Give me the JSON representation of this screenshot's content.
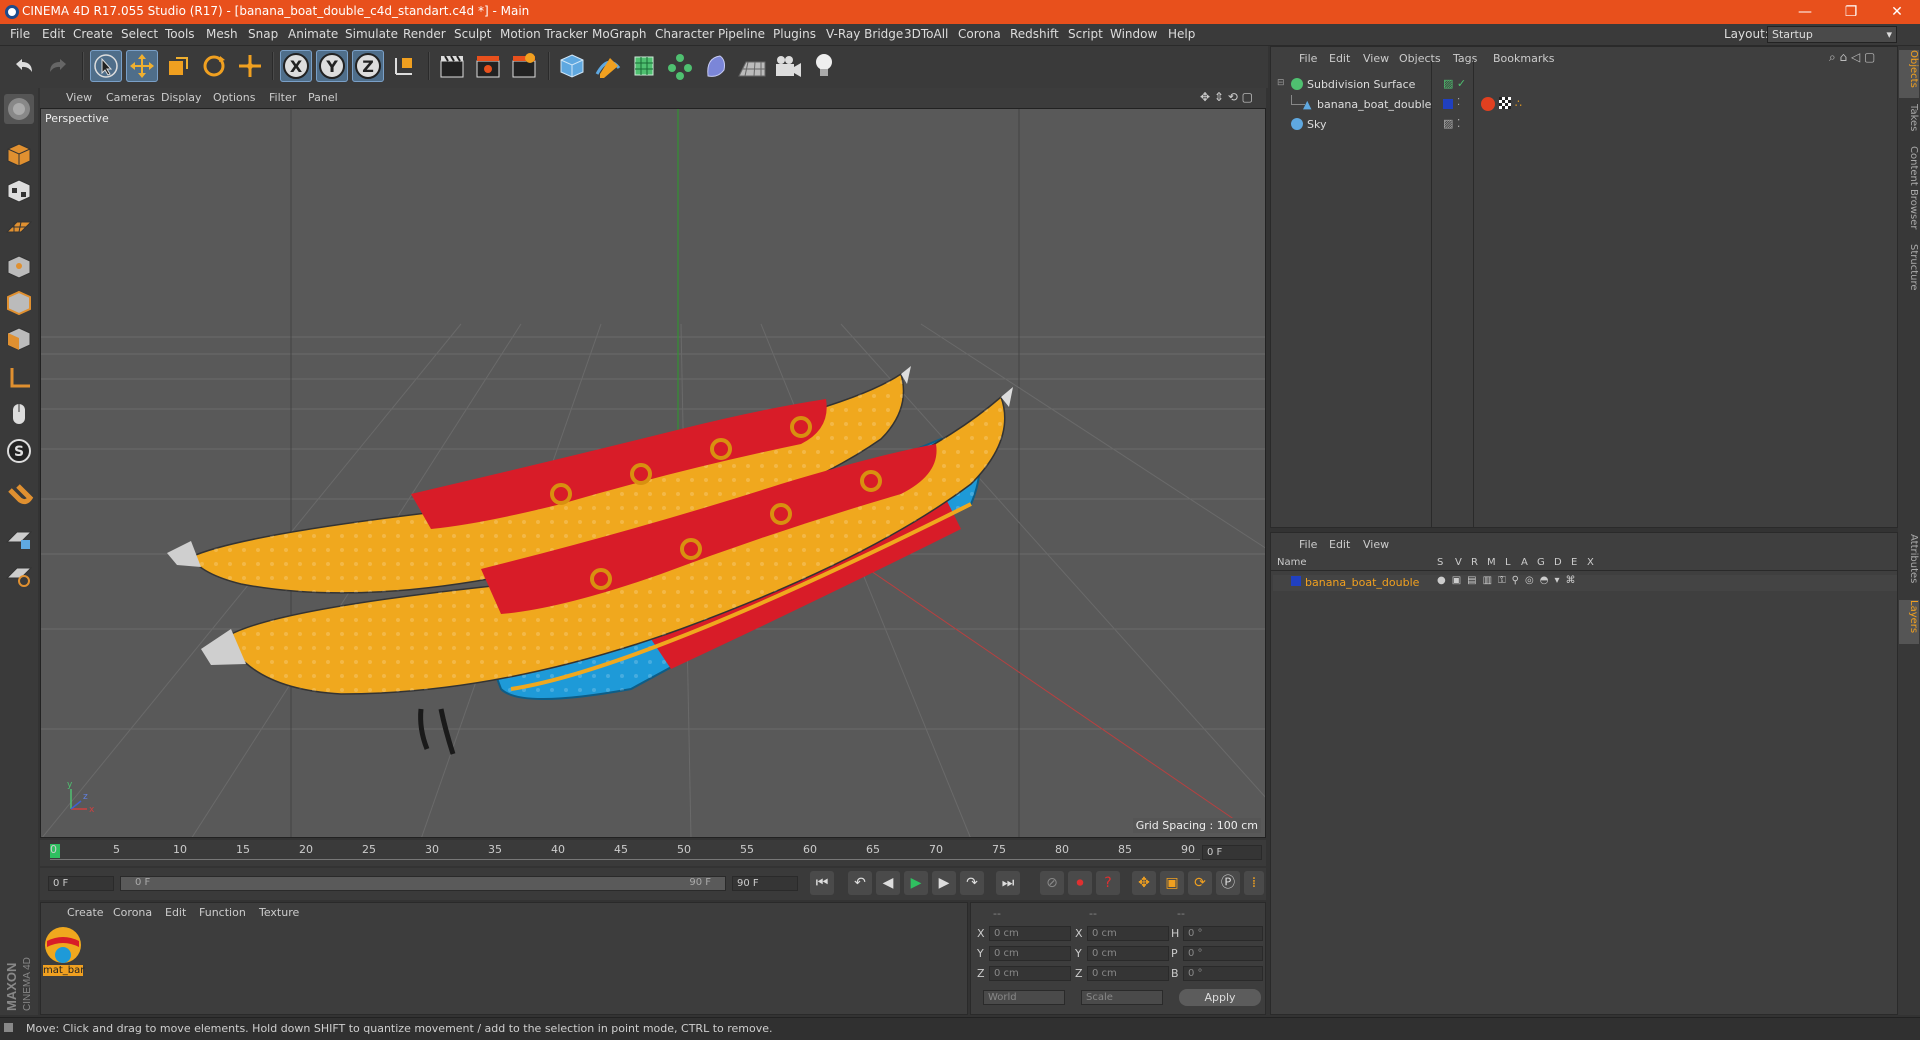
{
  "title_bar": {
    "title": "CINEMA 4D R17.055 Studio (R17) - [banana_boat_double_c4d_standart.c4d *] - Main",
    "controls": [
      "—",
      "❐",
      "✕"
    ]
  },
  "menu": {
    "items": [
      "File",
      "Edit",
      "Create",
      "Select",
      "Tools",
      "Mesh",
      "Snap",
      "Animate",
      "Simulate",
      "Render",
      "Sculpt",
      "Motion Tracker",
      "MoGraph",
      "Character",
      "Pipeline",
      "Plugins",
      "V-Ray Bridge",
      "3DToAll",
      "Corona",
      "Redshift",
      "Script",
      "Window",
      "Help"
    ],
    "layout_label": "Layout:",
    "layout_value": "Startup"
  },
  "toolbar": {
    "axis_x": "X",
    "axis_y": "Y",
    "axis_z": "Z"
  },
  "viewport": {
    "menu": [
      "View",
      "Cameras",
      "Display",
      "Options",
      "Filter",
      "Panel"
    ],
    "camera_label": "Perspective",
    "grid_spacing": "Grid Spacing : 100 cm"
  },
  "timeline": {
    "ticks": [
      "0",
      "5",
      "10",
      "15",
      "20",
      "25",
      "30",
      "35",
      "40",
      "45",
      "50",
      "55",
      "60",
      "65",
      "70",
      "75",
      "80",
      "85",
      "90"
    ],
    "current_frame": "0 F",
    "start_frame": "0 F",
    "range_start": "0 F",
    "range_end": "90 F",
    "end_frame": "90 F"
  },
  "material_panel": {
    "menu": [
      "Create",
      "Corona",
      "Edit",
      "Function",
      "Texture"
    ],
    "materials": [
      {
        "name": "mat_bar"
      }
    ]
  },
  "coordinates": {
    "headers": [
      "--",
      "--",
      "--"
    ],
    "rows": [
      {
        "l1": "X",
        "v1": "0 cm",
        "l2": "X",
        "v2": "0 cm",
        "l3": "H",
        "v3": "0 °"
      },
      {
        "l1": "Y",
        "v1": "0 cm",
        "l2": "Y",
        "v2": "0 cm",
        "l3": "P",
        "v3": "0 °"
      },
      {
        "l1": "Z",
        "v1": "0 cm",
        "l2": "Z",
        "v2": "0 cm",
        "l3": "B",
        "v3": "0 °"
      }
    ],
    "mode": "World",
    "type": "Scale",
    "apply": "Apply"
  },
  "objects_panel": {
    "menu": [
      "File",
      "Edit",
      "View",
      "Objects",
      "Tags",
      "Bookmarks"
    ],
    "objects": [
      {
        "name": "Subdivision Surface"
      },
      {
        "name": "banana_boat_double"
      },
      {
        "name": "Sky"
      }
    ]
  },
  "layers_panel": {
    "menu": [
      "File",
      "Edit",
      "View"
    ],
    "columns": [
      "Name",
      "S",
      "V",
      "R",
      "M",
      "L",
      "A",
      "G",
      "D",
      "E",
      "X"
    ],
    "layers": [
      {
        "name": "banana_boat_double"
      }
    ]
  },
  "right_tabs": [
    "Objects",
    "Takes",
    "Content Browser",
    "Structure",
    "Attributes",
    "Layers"
  ],
  "branding": "MAXON CINEMA 4D",
  "status": "Move: Click and drag to move elements. Hold down SHIFT to quantize movement / add to the selection in point mode, CTRL to remove.",
  "colors": {
    "title_bar": "#e8501c",
    "banana_yellow": "#f0a81e",
    "banana_red": "#d81c28",
    "base_blue": "#1e9ad8",
    "layer_name": "#f0a020"
  }
}
